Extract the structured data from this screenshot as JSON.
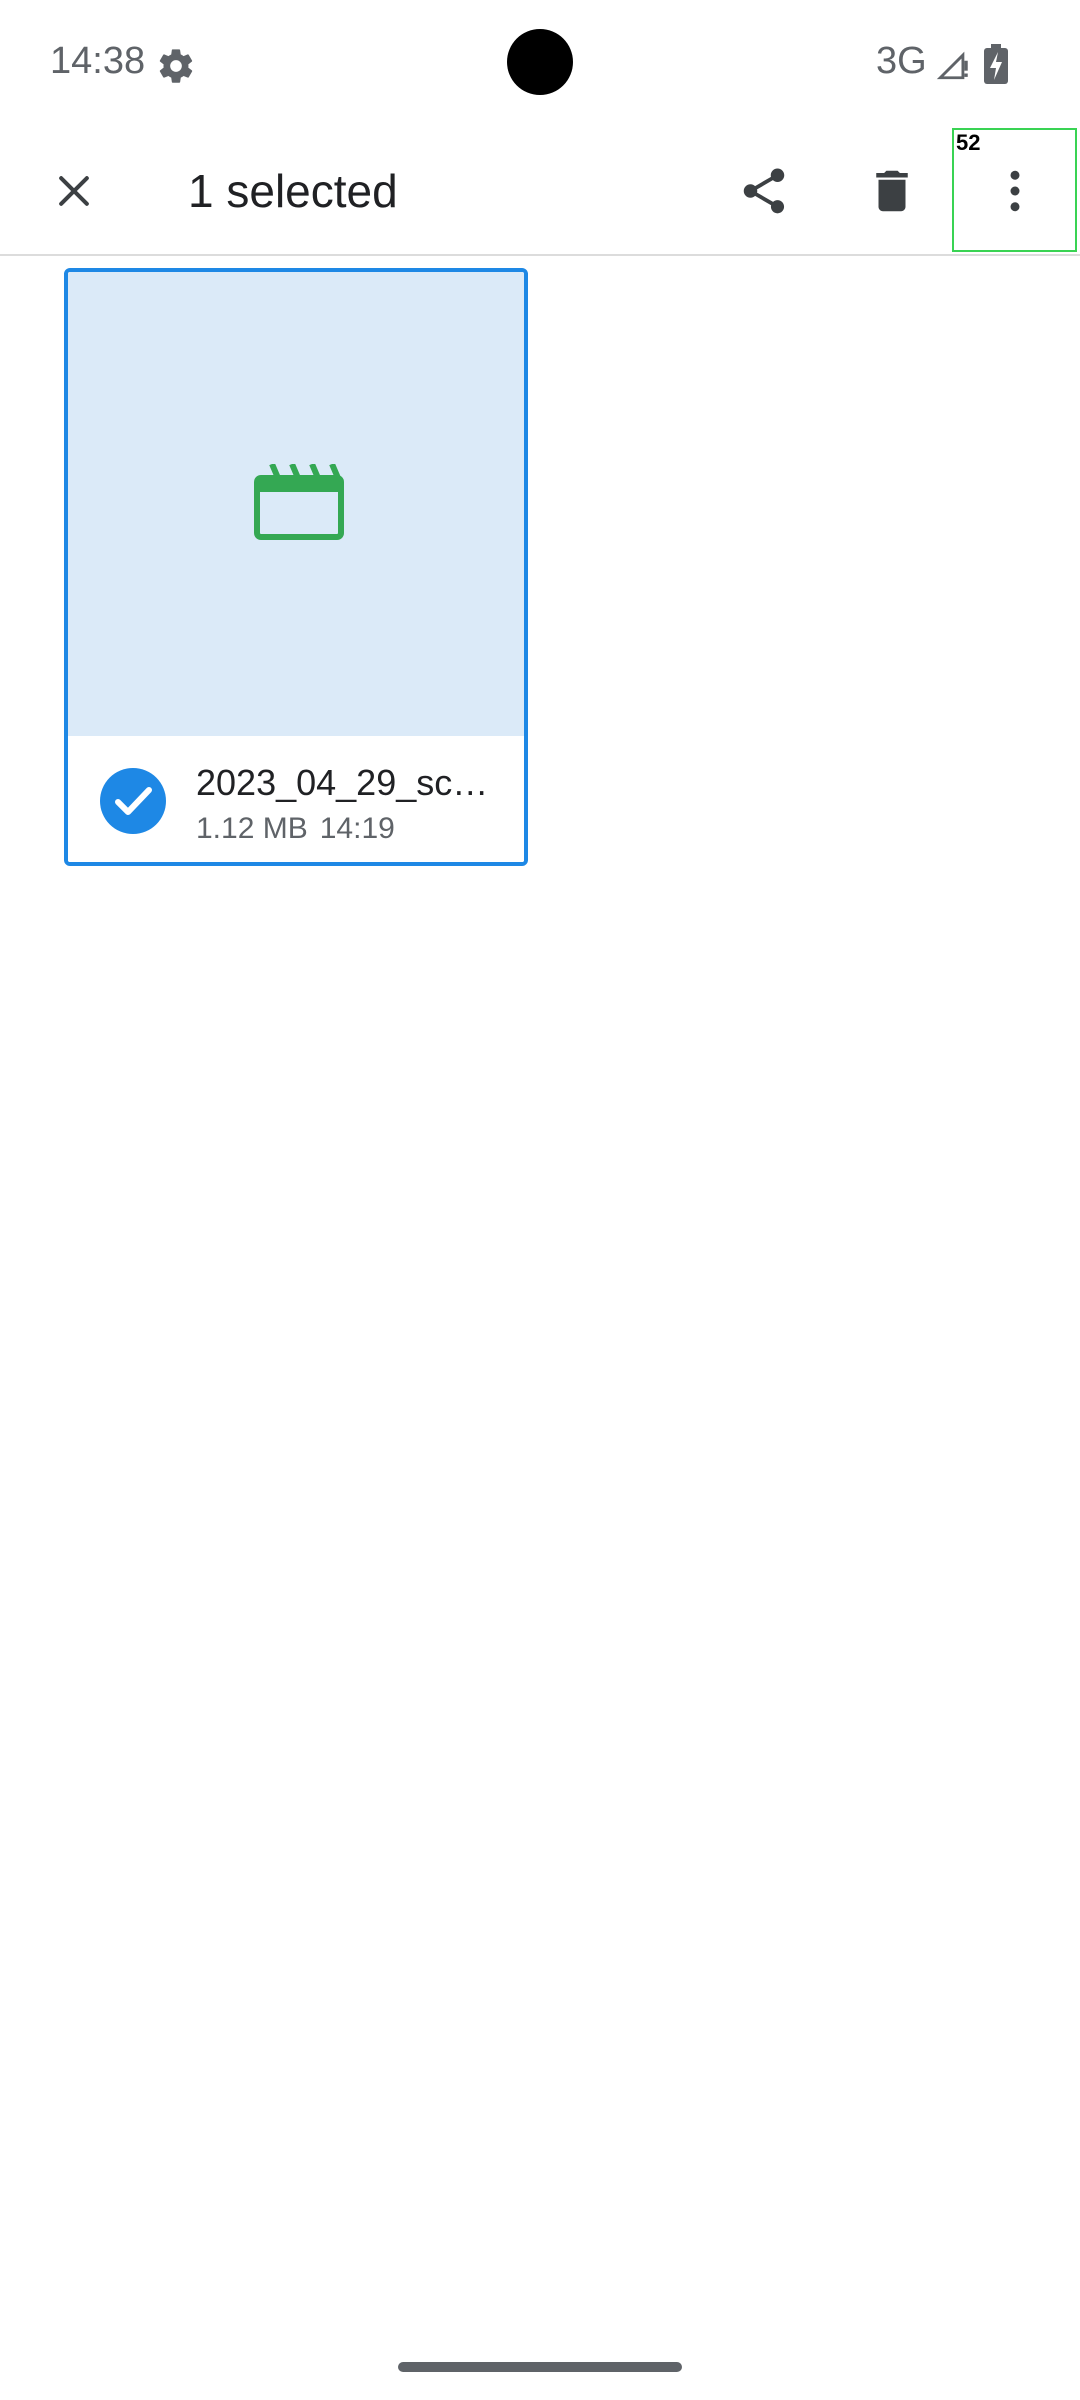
{
  "status_bar": {
    "time": "14:38",
    "network": "3G",
    "icons": [
      "settings-gear-icon",
      "signal-icon",
      "battery-charging-icon"
    ]
  },
  "toolbar": {
    "title": "1 selected",
    "icons": [
      "close-icon",
      "share-icon",
      "delete-icon",
      "more-vert-icon"
    ]
  },
  "overlay": {
    "label": "52",
    "color": "#39d353"
  },
  "file": {
    "name": "2023_04_29_sc…",
    "size": "1.12 MB",
    "time": "14:19",
    "selected": true,
    "type_icon": "video-icon"
  },
  "colors": {
    "accent": "#1e88e5",
    "thumb_bg": "#dbeaf8",
    "video_icon": "#34a853",
    "toolbar_icons": "#3c4043"
  }
}
